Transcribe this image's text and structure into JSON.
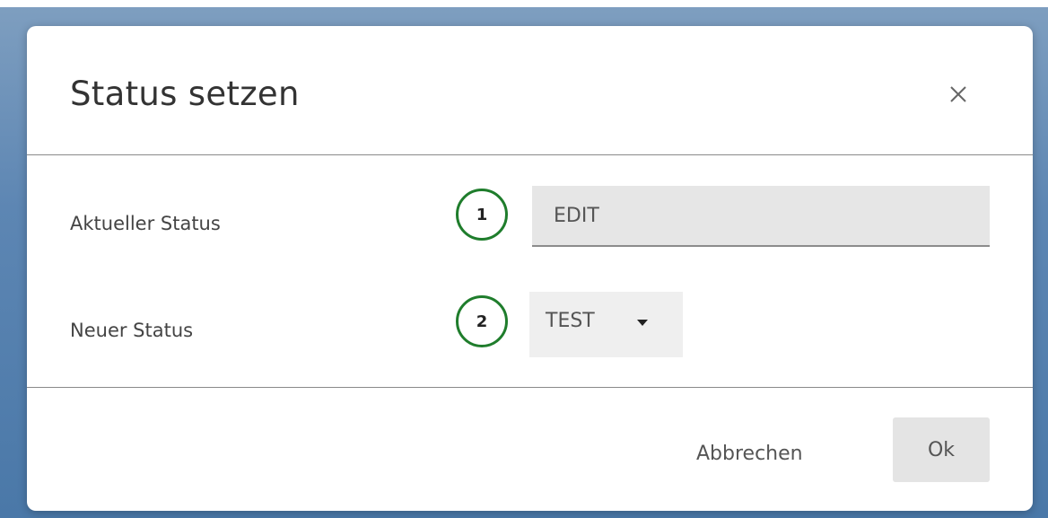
{
  "dialog": {
    "title": "Status setzen",
    "close_icon": "close-icon"
  },
  "fields": {
    "current": {
      "label": "Aktueller Status",
      "marker": "1",
      "value": "EDIT"
    },
    "new": {
      "label": "Neuer Status",
      "marker": "2",
      "selected": "TEST",
      "icon": "caret-down-icon"
    }
  },
  "footer": {
    "cancel_label": "Abbrechen",
    "ok_label": "Ok"
  },
  "colors": {
    "marker_border": "#1f7d2c",
    "input_background": "#e6e6e6",
    "backdrop": "#5d86b3"
  }
}
